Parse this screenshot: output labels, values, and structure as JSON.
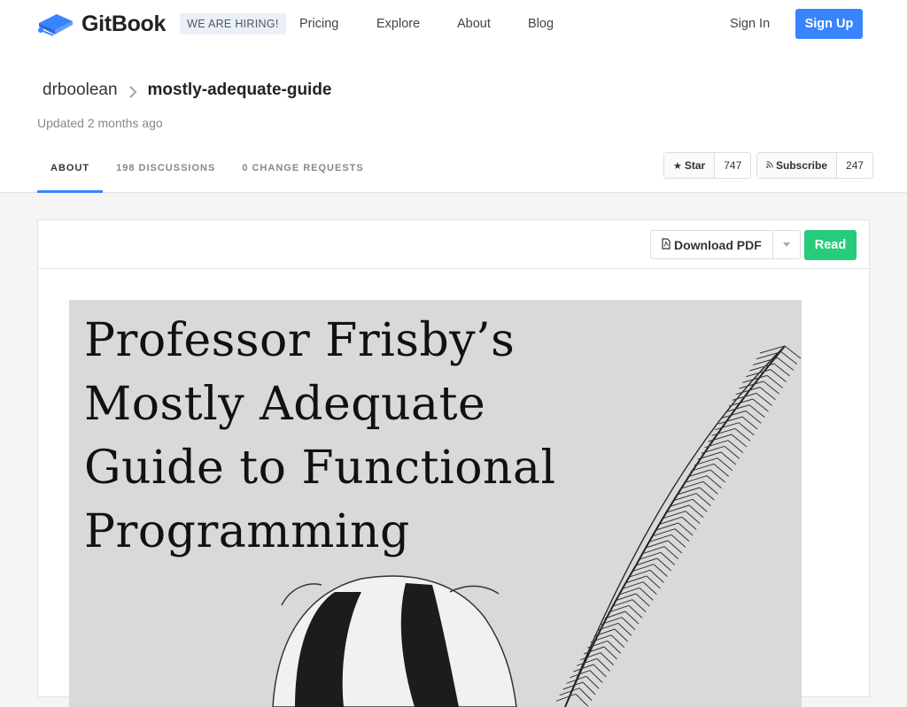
{
  "nav": {
    "brand": "GitBook",
    "hiring": "WE ARE HIRING!",
    "links": [
      "Pricing",
      "Explore",
      "About",
      "Blog"
    ],
    "sign_in": "Sign In",
    "sign_up": "Sign Up"
  },
  "repo": {
    "owner": "drboolean",
    "name": "mostly-adequate-guide",
    "updated": "Updated 2 months ago"
  },
  "tabs": [
    "ABOUT",
    "198 DISCUSSIONS",
    "0 CHANGE REQUESTS"
  ],
  "star": {
    "label": "Star",
    "count": "747"
  },
  "subscribe": {
    "label": "Subscribe",
    "count": "247"
  },
  "actions": {
    "download_pdf": "Download PDF",
    "read": "Read"
  },
  "cover": {
    "title_lines": [
      "Professor Frisby’s",
      "Mostly Adequate",
      "Guide to Functional",
      "Programming"
    ]
  },
  "colors": {
    "primary": "#3884ff",
    "read": "#26cb7c"
  },
  "icons": {
    "logo": "book-icon",
    "crumb_sep": "chevron-right-icon",
    "star": "star-icon",
    "subscribe": "rss-icon",
    "pdf": "pdf-file-icon",
    "caret": "caret-down-icon"
  }
}
